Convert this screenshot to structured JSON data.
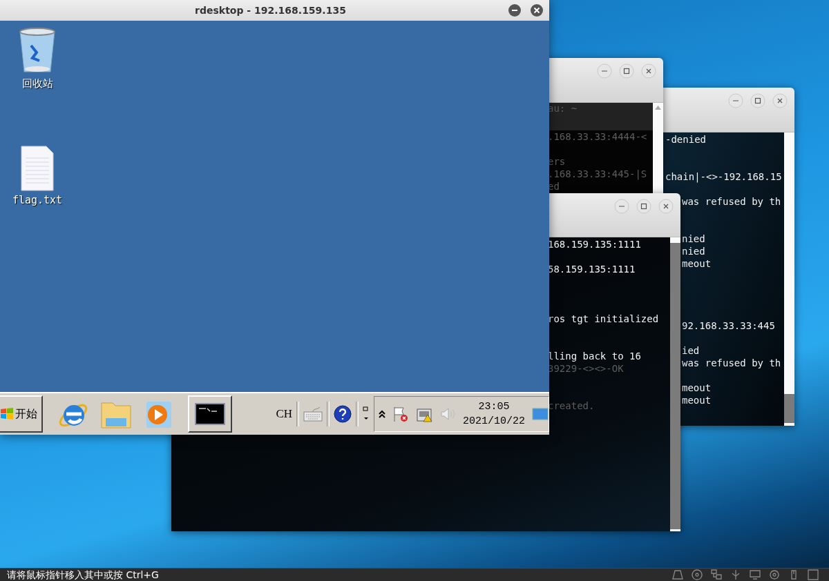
{
  "terminals": [
    {
      "header": "au: ~",
      "lines": [
        {
          "text": ".168.33.33:4444-<",
          "dim": true
        },
        {
          "text": "ers",
          "dim": true
        },
        {
          "text": ".168.33.33:445-|S",
          "dim": true
        },
        {
          "text": "ed",
          "dim": true
        }
      ]
    },
    {
      "lines": [
        {
          "text": "-denied",
          "dim": false
        },
        {
          "text": "chain|-<>-192.168.15",
          "dim": false
        },
        {
          "text": "was refused by th",
          "dim": false
        },
        {
          "text": "nied",
          "dim": false
        },
        {
          "text": "nied",
          "dim": false
        },
        {
          "text": "meout",
          "dim": false
        },
        {
          "text": "92.168.33.33:445",
          "dim": false
        },
        {
          "text": "ied",
          "dim": false
        },
        {
          "text": "was refused by th",
          "dim": false
        },
        {
          "text": "meout",
          "dim": false
        },
        {
          "text": "meout",
          "dim": false
        }
      ]
    },
    {
      "lines": [
        {
          "text": "168.159.135:1111",
          "dim": false
        },
        {
          "text": "58.159.135:1111",
          "dim": false
        },
        {
          "text": "ros tgt initialized",
          "dim": false
        },
        {
          "text": "lling back to 16",
          "dim": false
        },
        {
          "text": "39229-<><>-OK",
          "dim": true
        },
        {
          "text": "created.",
          "dim": true
        }
      ]
    }
  ],
  "remote_window": {
    "title": "rdesktop - 192.168.159.135",
    "desktop_icons": [
      {
        "kind": "bin",
        "label": "回收站"
      },
      {
        "kind": "file",
        "label": "flag.txt"
      }
    ],
    "taskbar": {
      "start_label": "开始",
      "language": "CH",
      "time": "23:05",
      "date": "2021/10/22"
    }
  },
  "status_bar": {
    "text": "请将鼠标指针移入其中或按 Ctrl+G"
  }
}
